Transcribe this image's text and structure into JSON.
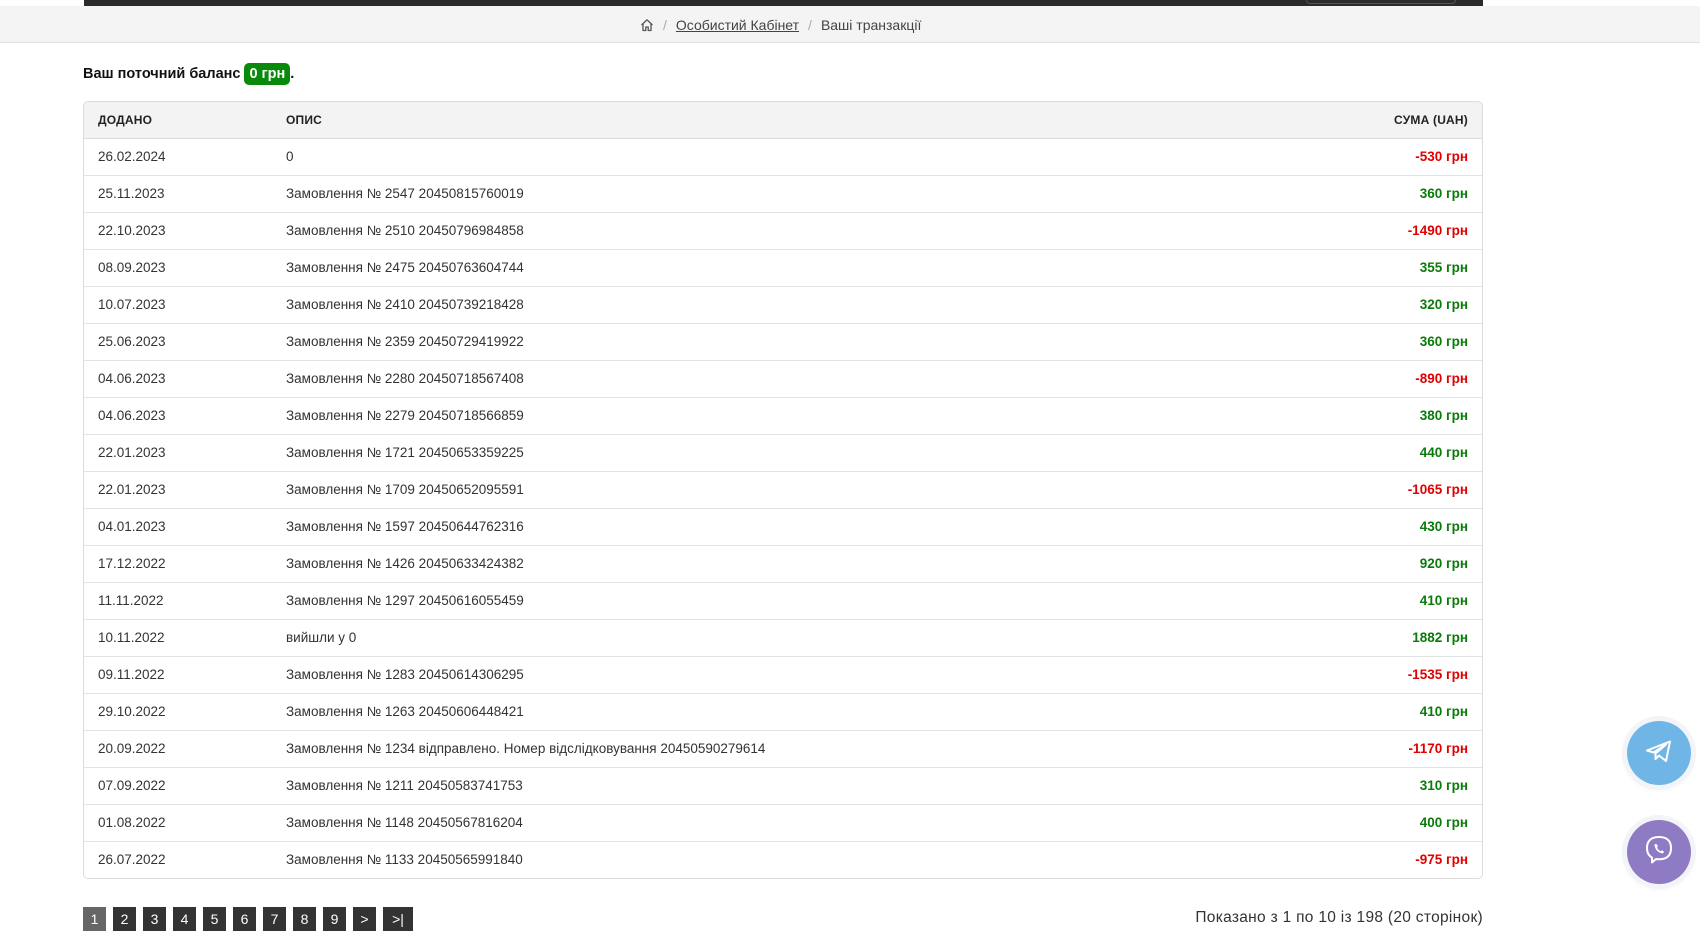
{
  "breadcrumb": {
    "home_icon": "home-icon",
    "cabinet": "Особистий Кабінет",
    "current": "Ваші транзакції"
  },
  "balance": {
    "label": "Ваш поточний баланс",
    "value": "0 грн",
    "suffix": "."
  },
  "table": {
    "headers": {
      "date": "ДОДАНО",
      "description": "ОПИС",
      "amount": "СУМА (UAH)"
    },
    "rows": [
      {
        "date": "26.02.2024",
        "description": "0",
        "amount": "-530 грн",
        "sign": "neg"
      },
      {
        "date": "25.11.2023",
        "description": "Замовлення № 2547 20450815760019",
        "amount": "360 грн",
        "sign": "pos"
      },
      {
        "date": "22.10.2023",
        "description": "Замовлення № 2510 20450796984858",
        "amount": "-1490 грн",
        "sign": "neg"
      },
      {
        "date": "08.09.2023",
        "description": "Замовлення № 2475 20450763604744",
        "amount": "355 грн",
        "sign": "pos"
      },
      {
        "date": "10.07.2023",
        "description": "Замовлення № 2410 20450739218428",
        "amount": "320 грн",
        "sign": "pos"
      },
      {
        "date": "25.06.2023",
        "description": "Замовлення № 2359 20450729419922",
        "amount": "360 грн",
        "sign": "pos"
      },
      {
        "date": "04.06.2023",
        "description": "Замовлення № 2280 20450718567408",
        "amount": "-890 грн",
        "sign": "neg"
      },
      {
        "date": "04.06.2023",
        "description": "Замовлення № 2279 20450718566859",
        "amount": "380 грн",
        "sign": "pos"
      },
      {
        "date": "22.01.2023",
        "description": "Замовлення № 1721 20450653359225",
        "amount": "440 грн",
        "sign": "pos"
      },
      {
        "date": "22.01.2023",
        "description": "Замовлення № 1709 20450652095591",
        "amount": "-1065 грн",
        "sign": "neg"
      },
      {
        "date": "04.01.2023",
        "description": "Замовлення № 1597 20450644762316",
        "amount": "430 грн",
        "sign": "pos"
      },
      {
        "date": "17.12.2022",
        "description": "Замовлення № 1426 20450633424382",
        "amount": "920 грн",
        "sign": "pos"
      },
      {
        "date": "11.11.2022",
        "description": "Замовлення № 1297 20450616055459",
        "amount": "410 грн",
        "sign": "pos"
      },
      {
        "date": "10.11.2022",
        "description": "вийшли у 0",
        "amount": "1882 грн",
        "sign": "pos"
      },
      {
        "date": "09.11.2022",
        "description": "Замовлення № 1283 20450614306295",
        "amount": "-1535 грн",
        "sign": "neg"
      },
      {
        "date": "29.10.2022",
        "description": "Замовлення № 1263 20450606448421",
        "amount": "410 грн",
        "sign": "pos"
      },
      {
        "date": "20.09.2022",
        "description": "Замовлення № 1234 відправлено. Номер відслідковування 20450590279614",
        "amount": "-1170 грн",
        "sign": "neg"
      },
      {
        "date": "07.09.2022",
        "description": "Замовлення № 1211 20450583741753",
        "amount": "310 грн",
        "sign": "pos"
      },
      {
        "date": "01.08.2022",
        "description": "Замовлення № 1148 20450567816204",
        "amount": "400 грн",
        "sign": "pos"
      },
      {
        "date": "26.07.2022",
        "description": "Замовлення № 1133 20450565991840",
        "amount": "-975 грн",
        "sign": "neg"
      }
    ]
  },
  "pagination": {
    "pages": [
      "1",
      "2",
      "3",
      "4",
      "5",
      "6",
      "7",
      "8",
      "9"
    ],
    "active": "1",
    "next": ">",
    "last": ">|"
  },
  "showing": "Показано з 1 по 10 із 198 (20 сторінок)",
  "floating": {
    "telegram_icon": "telegram-icon",
    "viber_icon": "viber-icon"
  },
  "colors": {
    "positive": "#0a7a0a",
    "negative": "#e00000",
    "balance_badge": "#0a8a0a"
  }
}
